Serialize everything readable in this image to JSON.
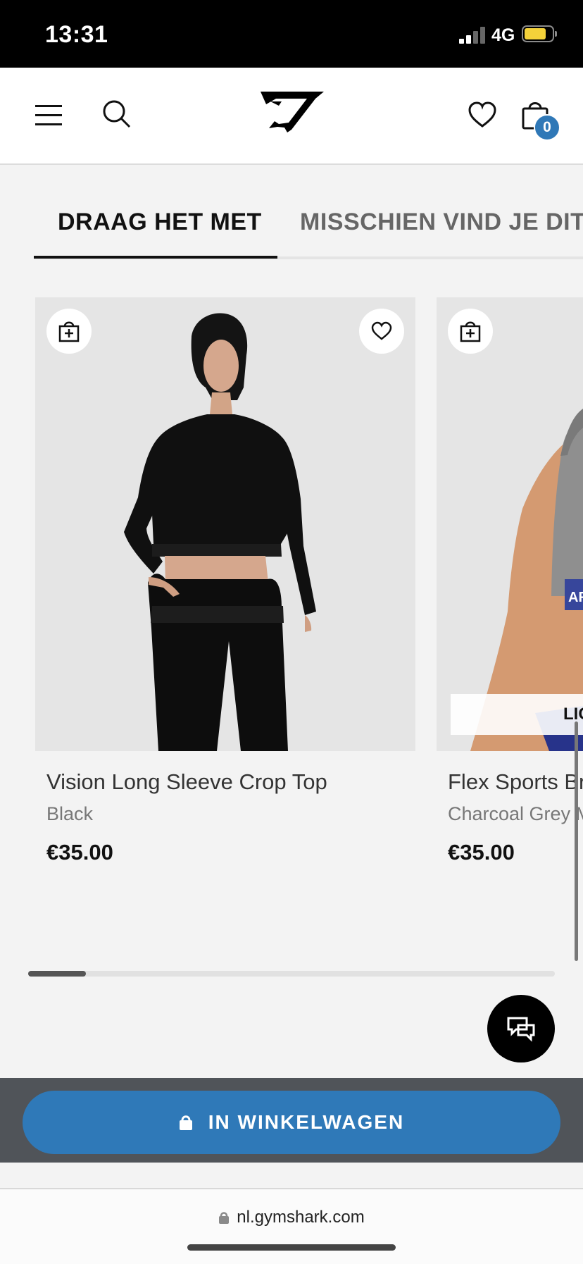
{
  "status_bar": {
    "time": "13:31",
    "network": "4G"
  },
  "nav": {
    "cart_count": "0",
    "menu_icon": "hamburger-icon",
    "search_icon": "search-icon",
    "logo_icon": "gymshark-logo-icon",
    "wishlist_icon": "heart-icon",
    "bag_icon": "shopping-bag-icon"
  },
  "tabs": {
    "items": [
      {
        "label": "DRAAG HET MET",
        "active": true
      },
      {
        "label": "MISSCHIEN VIND JE DIT",
        "active": false
      }
    ]
  },
  "products": [
    {
      "name": "Vision Long Sleeve Crop Top",
      "color": "Black",
      "price": "€35.00"
    },
    {
      "name": "Flex Sports Br",
      "color": "Charcoal Grey M",
      "price": "€35.00",
      "label": "LIG"
    }
  ],
  "carousel": {
    "progress": 0.11
  },
  "checkout": {
    "button_label": "IN WINKELWAGEN"
  },
  "browser": {
    "url": "nl.gymshark.com"
  },
  "colors": {
    "accent_blue": "#2f79b8",
    "bar_gray": "#505459",
    "background": "#f3f3f3"
  }
}
